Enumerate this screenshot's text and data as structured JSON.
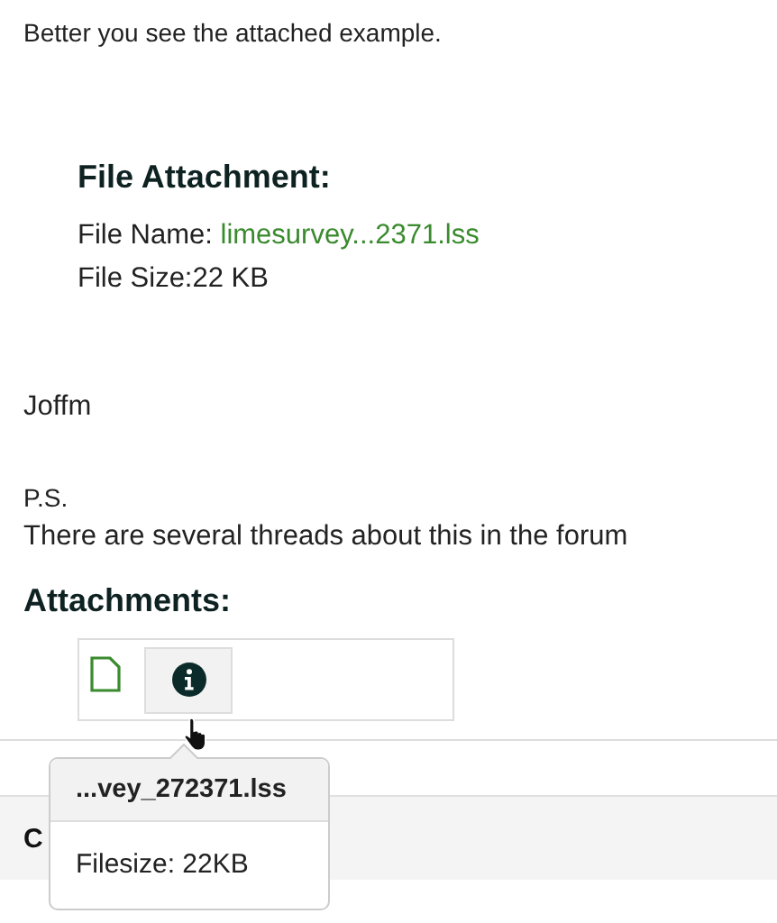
{
  "post": {
    "intro": "Better you see the attached example.",
    "file_attachment": {
      "heading": "File Attachment:",
      "name_label": "File Name: ",
      "name_link": "limesurvey...2371.lss",
      "size": "File Size:22 KB"
    },
    "signature": "Joffm",
    "ps_label": "P.S.",
    "ps_text": "There are several threads about this in the forum"
  },
  "attachments": {
    "heading": "Attachments:"
  },
  "tooltip": {
    "title": "...vey_272371.lss",
    "body": "Filesize: 22KB"
  },
  "next_bar": {
    "label": "C"
  }
}
